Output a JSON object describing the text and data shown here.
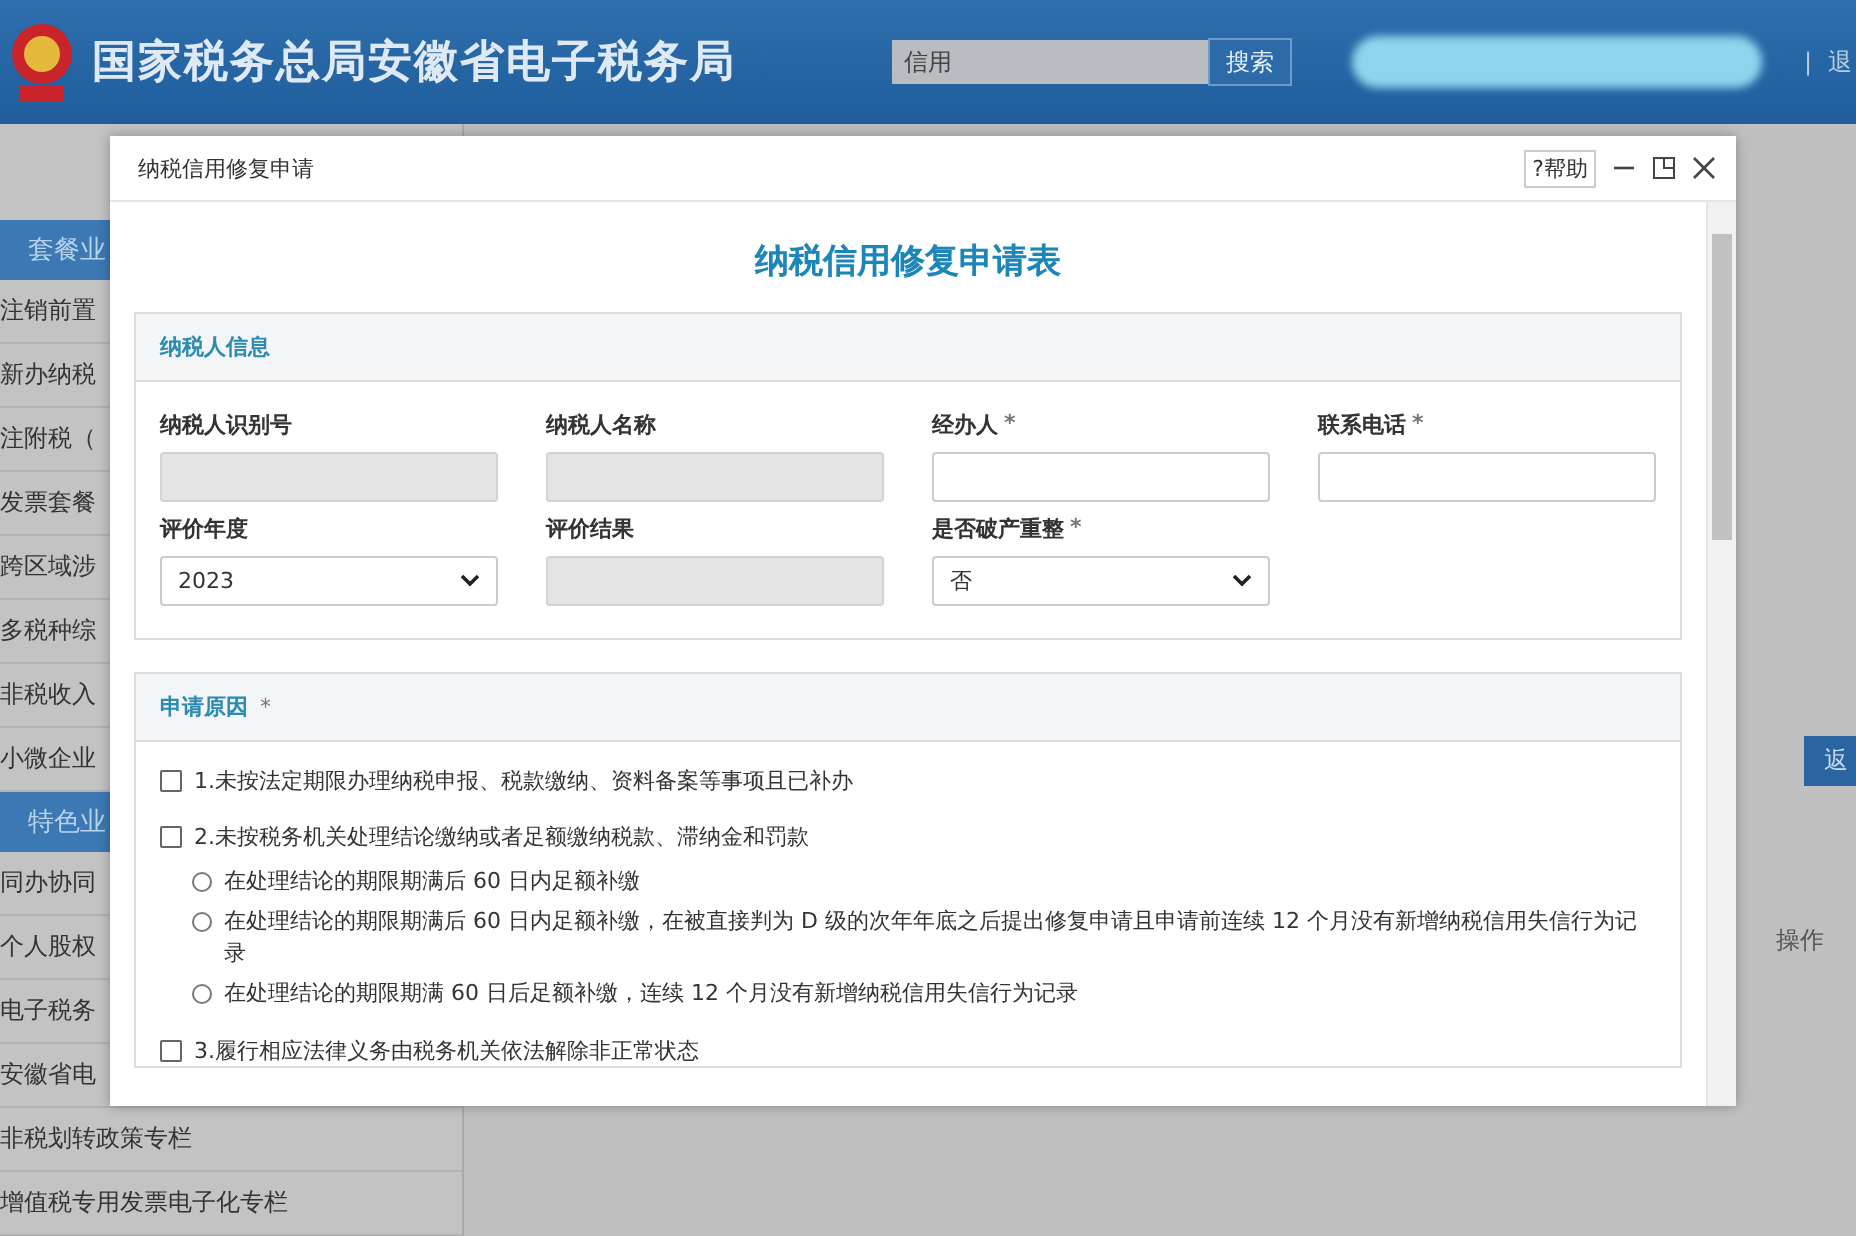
{
  "header": {
    "title": "国家税务总局安徽省电子税务局",
    "search": {
      "value": "信用"
    },
    "search_button": "搜索",
    "separator": "|",
    "logout": "退"
  },
  "sidebar": {
    "sections": [
      {
        "title": "套餐业",
        "items": [
          "注销前置",
          "新办纳税",
          "注附税（",
          "发票套餐",
          "跨区域涉",
          "多税种综",
          "非税收入",
          "小微企业"
        ]
      },
      {
        "title": "特色业",
        "items": [
          "同办协同",
          "个人股权",
          "电子税务",
          "安徽省电",
          "非税划转政策专栏",
          "增值税专用发票电子化专栏"
        ]
      }
    ]
  },
  "background": {
    "button": "返",
    "column": "操作"
  },
  "dialog": {
    "title": "纳税信用修复申请",
    "help": "?帮助",
    "form_title": "纳税信用修复申请表",
    "info_panel": {
      "title": "纳税人信息",
      "fields": [
        {
          "label": "纳税人识别号",
          "kind": "text",
          "disabled": true
        },
        {
          "label": "纳税人名称",
          "kind": "text",
          "disabled": true
        },
        {
          "label": "经办人",
          "required_mark": "*",
          "kind": "text",
          "disabled": false
        },
        {
          "label": "联系电话",
          "required_mark": "*",
          "kind": "text",
          "disabled": false
        },
        {
          "label": "评价年度",
          "kind": "select",
          "value": "2023",
          "disabled": false
        },
        {
          "label": "评价结果",
          "kind": "text",
          "disabled": true
        },
        {
          "label": "是否破产重整",
          "required_mark": "*",
          "kind": "select",
          "value": "否",
          "disabled": false
        }
      ]
    },
    "reason_panel": {
      "title": "申请原因",
      "required_mark": "*",
      "options": [
        {
          "label": "1.未按法定期限办理纳税申报、税款缴纳、资料备案等事项且已补办",
          "checked": false
        },
        {
          "label": "2.未按税务机关处理结论缴纳或者足额缴纳税款、滞纳金和罚款",
          "checked": false,
          "children": [
            {
              "label": "在处理结论的期限期满后 60 日内足额补缴",
              "selected": false
            },
            {
              "label": "在处理结论的期限期满后 60 日内足额补缴，在被直接判为 D 级的次年年底之后提出修复申请且申请前连续 12 个月没有新增纳税信用失信行为记录",
              "selected": false
            },
            {
              "label": "在处理结论的期限期满 60 日后足额补缴，连续 12 个月没有新增纳税信用失信行为记录",
              "selected": false
            }
          ]
        },
        {
          "label": "3.履行相应法律义务由税务机关依法解除非正常状态",
          "checked": false
        }
      ]
    }
  }
}
